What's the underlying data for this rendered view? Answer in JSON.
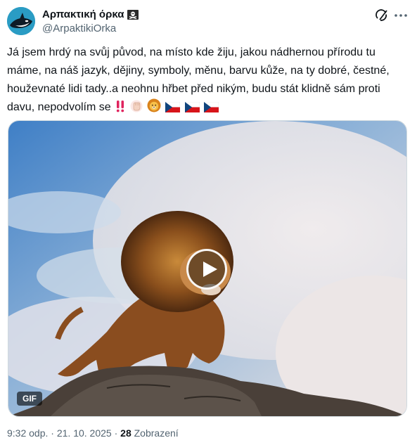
{
  "author": {
    "display_name": "Αρπακτική όρκα",
    "handle": "@ArpaktikiOrka",
    "badge_icon": "skull-crossbones-flag-icon",
    "avatar_icon": "orca-avatar-icon"
  },
  "header_icons": {
    "grok": "grok-icon",
    "more": "more-options-icon"
  },
  "tweet": {
    "text": "Já jsem hrdý na svůj původ, na místo kde žiju, jakou nádhernou přírodu tu máme, na náš jazyk, dějiny, symboly, měnu, barvu kůže, na ty dobré, čestné, houževnaté lidi tady..a neohnu hřbet před nikým, budu stát klidně sám proti davu, nepodvolím se",
    "emojis": [
      "double-exclamation-icon",
      "raised-fist-icon",
      "lion-face-icon",
      "czech-flag-icon",
      "czech-flag-icon",
      "czech-flag-icon"
    ]
  },
  "media": {
    "type": "GIF",
    "badge": "GIF",
    "play_icon": "play-icon",
    "description_icon": "lion-on-rock-image"
  },
  "meta": {
    "time": "9:32 odp.",
    "separator": "·",
    "date": "21. 10. 2025",
    "views_count": "28",
    "views_label": "Zobrazení"
  },
  "colors": {
    "text": "#0f1419",
    "secondary": "#536471",
    "border": "#cfd9de",
    "flag_white": "#ffffff",
    "flag_red": "#d7141a",
    "flag_blue": "#11457e"
  }
}
